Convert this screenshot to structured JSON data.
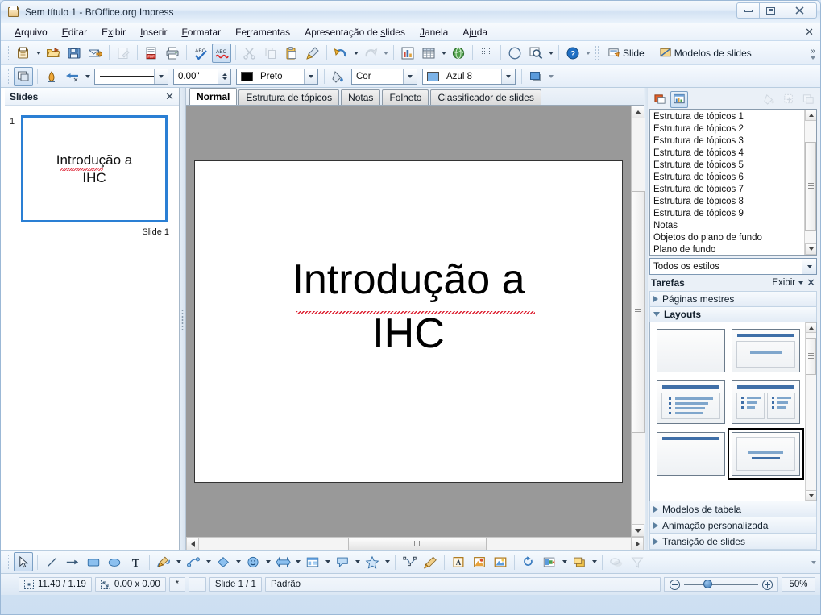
{
  "window": {
    "title": "Sem título 1 - BrOffice.org Impress",
    "icon": "impress-document-icon",
    "minimize_label": "Minimizar",
    "maximize_label": "Maximizar",
    "close_label": "Fechar"
  },
  "menubar": {
    "items": [
      {
        "label": "Arquivo",
        "accel": "A"
      },
      {
        "label": "Editar",
        "accel": "E"
      },
      {
        "label": "Exibir",
        "accel": "x"
      },
      {
        "label": "Inserir",
        "accel": "I"
      },
      {
        "label": "Formatar",
        "accel": "F"
      },
      {
        "label": "Ferramentas",
        "accel": "r"
      },
      {
        "label": "Apresentação de slides",
        "accel": "s"
      },
      {
        "label": "Janela",
        "accel": "J"
      },
      {
        "label": "Ajuda",
        "accel": "u"
      }
    ],
    "close_document": "✕"
  },
  "toolbar_standard": {
    "buttons": [
      {
        "name": "new-document",
        "icon": "new-doc-icon",
        "has_dropdown": true,
        "enabled": true
      },
      {
        "name": "open",
        "icon": "open-folder-icon",
        "enabled": true
      },
      {
        "name": "save",
        "icon": "save-floppy-icon",
        "enabled": true
      },
      {
        "name": "send-document-as-email",
        "icon": "email-icon",
        "enabled": true
      },
      {
        "name": "edit-file",
        "icon": "edit-file-icon",
        "enabled": false
      },
      {
        "name": "export-as-pdf",
        "icon": "pdf-icon",
        "enabled": true
      },
      {
        "name": "print-file-directly",
        "icon": "printer-icon",
        "enabled": true
      },
      {
        "name": "spelling-and-grammar",
        "icon": "abc-check-icon",
        "enabled": true
      },
      {
        "name": "autospellcheck",
        "icon": "abc-squiggle-icon",
        "enabled": true,
        "active": true
      },
      {
        "name": "cut",
        "icon": "scissors-icon",
        "enabled": false
      },
      {
        "name": "copy",
        "icon": "copy-icon",
        "enabled": false
      },
      {
        "name": "paste",
        "icon": "clipboard-icon",
        "enabled": true
      },
      {
        "name": "clone-formatting",
        "icon": "paintbrush-icon",
        "enabled": true
      },
      {
        "name": "undo",
        "icon": "undo-arrow-icon",
        "has_dropdown": true,
        "enabled": true
      },
      {
        "name": "redo",
        "icon": "redo-arrow-icon",
        "has_dropdown": true,
        "enabled": false
      },
      {
        "name": "insert-chart",
        "icon": "bar-chart-icon",
        "enabled": true
      },
      {
        "name": "insert-table",
        "icon": "table-grid-icon",
        "has_dropdown": true,
        "enabled": true
      },
      {
        "name": "insert-image",
        "icon": "image-globe-icon",
        "enabled": true
      },
      {
        "name": "display-grid",
        "icon": "grid-dots-icon",
        "enabled": true
      },
      {
        "name": "hyperlink",
        "icon": "compass-icon",
        "enabled": true
      },
      {
        "name": "zoom",
        "icon": "magnifier-icon",
        "has_dropdown": true,
        "enabled": true
      },
      {
        "name": "help",
        "icon": "help-question-icon",
        "enabled": true
      }
    ],
    "slide_button_label": "Slide",
    "slide_button_icon": "new-slide-icon",
    "master_button_label": "Modelos de slides",
    "master_button_icon": "slide-master-icon",
    "overflow": "»"
  },
  "toolbar_lineandfill": {
    "properties_icon": "object-properties-icon",
    "pen_icon": "line-endpoint-icon",
    "arrow_style_icon": "arrow-style-icon",
    "line_style": "",
    "line_style_name": "solid-line",
    "line_width": "0.00\"",
    "line_color_name": "Preto",
    "line_color_hex": "#000000",
    "area_style_icon": "area-fill-icon",
    "area_style": "Cor",
    "fill_color_name": "Azul 8",
    "fill_color_hex": "#7cb3e8",
    "shadow_icon": "shadow-icon"
  },
  "slides_panel": {
    "title": "Slides",
    "close": "✕",
    "slides": [
      {
        "number": "1",
        "title": "Introdução a IHC",
        "caption": "Slide 1",
        "selected": true
      }
    ]
  },
  "view_tabs": [
    {
      "label": "Normal",
      "active": true
    },
    {
      "label": "Estrutura de tópicos",
      "active": false
    },
    {
      "label": "Notas",
      "active": false
    },
    {
      "label": "Folheto",
      "active": false
    },
    {
      "label": "Classificador de slides",
      "active": false
    }
  ],
  "slide_canvas": {
    "title_line1": "Introdução a",
    "title_line2": "IHC",
    "spellcheck_underline": true,
    "background": "#ffffff"
  },
  "styles_panel": {
    "buttons": [
      {
        "name": "graphic-styles",
        "icon": "graphic-styles-icon",
        "active": false
      },
      {
        "name": "presentation-styles",
        "icon": "presentation-styles-icon",
        "active": true
      },
      {
        "name": "fill-format-mode",
        "icon": "fill-format-icon",
        "enabled": false
      },
      {
        "name": "new-style-from-selection",
        "icon": "new-style-icon",
        "enabled": false
      },
      {
        "name": "update-style",
        "icon": "update-style-icon",
        "enabled": false
      }
    ],
    "items": [
      "Estrutura de tópicos 1",
      "Estrutura de tópicos 2",
      "Estrutura de tópicos 3",
      "Estrutura de tópicos 4",
      "Estrutura de tópicos 5",
      "Estrutura de tópicos 6",
      "Estrutura de tópicos 7",
      "Estrutura de tópicos 8",
      "Estrutura de tópicos 9",
      "Notas",
      "Objetos do plano de fundo",
      "Plano de fundo"
    ],
    "filter": "Todos os estilos"
  },
  "tasks_panel": {
    "title": "Tarefas",
    "view_label": "Exibir",
    "close": "✕",
    "sections": [
      {
        "label": "Páginas mestres",
        "expanded": false
      },
      {
        "label": "Layouts",
        "expanded": true
      },
      {
        "label": "Modelos de tabela",
        "expanded": false
      },
      {
        "label": "Animação personalizada",
        "expanded": false
      },
      {
        "label": "Transição de slides",
        "expanded": false
      }
    ],
    "layouts": [
      {
        "name": "blank-slide",
        "selected": false
      },
      {
        "name": "title-content",
        "selected": false
      },
      {
        "name": "title-bullets",
        "selected": false
      },
      {
        "name": "title-two-content",
        "selected": false
      },
      {
        "name": "title-only",
        "selected": false
      },
      {
        "name": "centered-text",
        "selected": true
      }
    ]
  },
  "draw_toolbar": {
    "buttons": [
      {
        "name": "select",
        "icon": "cursor-arrow-icon",
        "active": true
      },
      {
        "name": "line",
        "icon": "line-icon"
      },
      {
        "name": "line-ends-with-arrow",
        "icon": "arrow-icon"
      },
      {
        "name": "rectangle",
        "icon": "rectangle-icon"
      },
      {
        "name": "ellipse",
        "icon": "ellipse-icon"
      },
      {
        "name": "text-box",
        "icon": "text-t-icon"
      },
      {
        "name": "curve",
        "icon": "curve-pencil-icon",
        "has_dropdown": true
      },
      {
        "name": "connector",
        "icon": "connector-icon",
        "has_dropdown": true
      },
      {
        "name": "basic-shapes",
        "icon": "diamond-shape-icon",
        "has_dropdown": true
      },
      {
        "name": "symbol-shapes",
        "icon": "smiley-icon",
        "has_dropdown": true
      },
      {
        "name": "block-arrows",
        "icon": "block-arrow-icon",
        "has_dropdown": true
      },
      {
        "name": "flowchart",
        "icon": "flowchart-icon",
        "has_dropdown": true
      },
      {
        "name": "callouts",
        "icon": "callout-balloon-icon",
        "has_dropdown": true
      },
      {
        "name": "stars",
        "icon": "star-icon",
        "has_dropdown": true
      },
      {
        "name": "points",
        "icon": "edit-points-icon"
      },
      {
        "name": "glue-points",
        "icon": "glue-points-pen-icon"
      },
      {
        "name": "fontwork-gallery",
        "icon": "fontwork-icon"
      },
      {
        "name": "from-file",
        "icon": "insert-image-file-icon"
      },
      {
        "name": "gallery",
        "icon": "gallery-frame-icon"
      },
      {
        "name": "rotate",
        "icon": "rotate-icon"
      },
      {
        "name": "alignment",
        "icon": "align-objects-icon",
        "has_dropdown": true
      },
      {
        "name": "arrange",
        "icon": "arrange-objects-icon",
        "has_dropdown": true
      },
      {
        "name": "shadow",
        "icon": "object-shadow-icon",
        "enabled": false
      },
      {
        "name": "filter",
        "icon": "filter-icon",
        "enabled": false
      }
    ]
  },
  "statusbar": {
    "cursor_position": "11.40 / 1.19",
    "cursor_position_icon": "position-icon",
    "object_size": "0.00 x 0.00",
    "object_size_icon": "size-icon",
    "modified_flag": "*",
    "signature": "",
    "slide_indicator": "Slide 1 / 1",
    "master_name": "Padrão",
    "zoom_out_label": "−",
    "zoom_in_label": "+",
    "zoom_level": "50%"
  }
}
